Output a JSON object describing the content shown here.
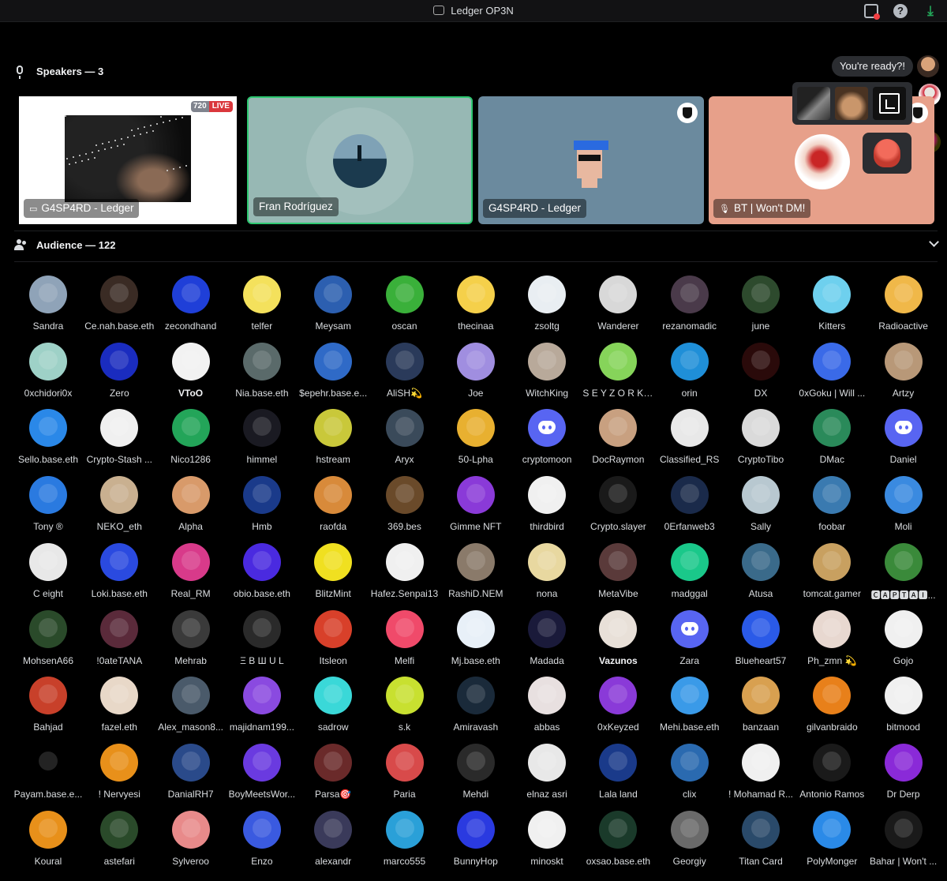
{
  "window": {
    "title": "Ledger OP3N"
  },
  "speakers": {
    "header": "Speakers — 3",
    "tiles": [
      {
        "label": "G4SP4RD - Ledger",
        "label_icon": "screen-share-icon",
        "badge_quality": "720",
        "badge_live": "LIVE"
      },
      {
        "label": "Fran Rodríguez",
        "speaking": true
      },
      {
        "label": "G4SP4RD - Ledger",
        "badge_icon": "shield-icon"
      },
      {
        "label": "BT | Won't DM!",
        "label_icon": "muted-mic-icon",
        "badge_icon": "shield-icon"
      }
    ]
  },
  "overlay": {
    "ready_text": "You're ready?!"
  },
  "audience": {
    "header": "Audience — 122",
    "members": [
      {
        "name": "Sandra",
        "color": "#8fa3b8"
      },
      {
        "name": "Ce.nah.base.eth",
        "color": "#3a2b24"
      },
      {
        "name": "zecondhand",
        "color": "#1f3fd8"
      },
      {
        "name": "telfer",
        "color": "#f4e15c"
      },
      {
        "name": "Meysam",
        "color": "#2c5fb0"
      },
      {
        "name": "oscan",
        "color": "#3ab03a"
      },
      {
        "name": "thecinaa",
        "color": "#f5d04a"
      },
      {
        "name": "zsoltg",
        "color": "#e9eef2"
      },
      {
        "name": "Wanderer",
        "color": "#d8d8d8"
      },
      {
        "name": "rezanomadic",
        "color": "#4a3a4a"
      },
      {
        "name": "june",
        "color": "#2d4a2d"
      },
      {
        "name": "Kitters",
        "color": "#6ed0ee"
      },
      {
        "name": "Radioactive",
        "color": "#f0b849"
      },
      {
        "name": "0xchidori0x",
        "color": "#9ed1c7"
      },
      {
        "name": "Zero",
        "color": "#1a2cbf"
      },
      {
        "name": "VToO",
        "color": "#f2f2f2",
        "bold": true
      },
      {
        "name": "Nia.base.eth",
        "color": "#5a6a6a"
      },
      {
        "name": "$epehr.base.e...",
        "color": "#2f6ac7"
      },
      {
        "name": "AliSH💫",
        "color": "#2a3a5a"
      },
      {
        "name": "Joe",
        "color": "#a08ee0"
      },
      {
        "name": "WitchKing",
        "color": "#b8a99a"
      },
      {
        "name": "S E Y Z O R K ...",
        "color": "#86d45a"
      },
      {
        "name": "orin",
        "color": "#1f8fd8"
      },
      {
        "name": "DX",
        "color": "#2a0a0a"
      },
      {
        "name": "0xGoku | Will ...",
        "color": "#3a6ae8"
      },
      {
        "name": "Artzy",
        "color": "#b89878"
      },
      {
        "name": "Sello.base.eth",
        "color": "#2a88e8"
      },
      {
        "name": "Crypto-Stash ...",
        "color": "#f0f0f0"
      },
      {
        "name": "Nico1286",
        "color": "#23a559"
      },
      {
        "name": "himmel",
        "color": "#1a1a22"
      },
      {
        "name": "hstream",
        "color": "#c9c83a"
      },
      {
        "name": "Aryx",
        "color": "#3a4a5a"
      },
      {
        "name": "50-Lpha",
        "color": "#e8b030"
      },
      {
        "name": "cryptomoon",
        "color": "#5865f2",
        "discord": true
      },
      {
        "name": "DocRaymon",
        "color": "#c8a080"
      },
      {
        "name": "Classified_RS",
        "color": "#e8e8e8"
      },
      {
        "name": "CryptoTibo",
        "color": "#dadada"
      },
      {
        "name": "DMac",
        "color": "#2a8a5a"
      },
      {
        "name": "Daniel",
        "color": "#eb459e",
        "discord": true
      },
      {
        "name": "Tony ®",
        "color": "#2a7ae0"
      },
      {
        "name": "NEKO_eth",
        "color": "#c9b090"
      },
      {
        "name": "Alpha",
        "color": "#d89a6a"
      },
      {
        "name": "Hmb",
        "color": "#1a3a8a"
      },
      {
        "name": "raofda",
        "color": "#d88a3a"
      },
      {
        "name": "369.bes",
        "color": "#6a4a2a"
      },
      {
        "name": "Gimme NFT",
        "color": "#8a3ad8"
      },
      {
        "name": "thirdbird",
        "color": "#f0f0f0"
      },
      {
        "name": "Crypto.slayer",
        "color": "#1a1a1a"
      },
      {
        "name": "0Erfanweb3",
        "color": "#1a2a4a"
      },
      {
        "name": "Sally",
        "color": "#b8c8d0"
      },
      {
        "name": "foobar",
        "color": "#3a7ab0"
      },
      {
        "name": "Moli",
        "color": "#3a8ae0"
      },
      {
        "name": "C eight",
        "color": "#e8e8e8"
      },
      {
        "name": "Loki.base.eth",
        "color": "#2a4ae0"
      },
      {
        "name": "Real_RM",
        "color": "#d83a8a"
      },
      {
        "name": "obio.base.eth",
        "color": "#4a2ae0"
      },
      {
        "name": "BlitzMint",
        "color": "#f0e020"
      },
      {
        "name": "Hafez.Senpai13",
        "color": "#f0f0f0"
      },
      {
        "name": "RashiD.NEM",
        "color": "#8a7a6a"
      },
      {
        "name": "nona",
        "color": "#e8d8a0"
      },
      {
        "name": "MetaVibe",
        "color": "#5a3a3a"
      },
      {
        "name": "madggal",
        "color": "#1ac88a"
      },
      {
        "name": "Atusa",
        "color": "#3a6a8a"
      },
      {
        "name": "tomcat.gamer",
        "color": "#c8a060"
      },
      {
        "name": "🅲🅰🅿🆃🅰🅸...",
        "color": "#3a8a3a"
      },
      {
        "name": "MohsenA66",
        "color": "#2a4a2a"
      },
      {
        "name": "!0ateTANA",
        "color": "#5a2a3a"
      },
      {
        "name": "Mehrab",
        "color": "#3a3a3a"
      },
      {
        "name": "Ξ В Ш U L",
        "color": "#2a2a2a"
      },
      {
        "name": "Itsleon",
        "color": "#d8402a"
      },
      {
        "name": "Melfi",
        "color": "#f04a6a"
      },
      {
        "name": "Mj.base.eth",
        "color": "#e8f0f8"
      },
      {
        "name": "Madada",
        "color": "#1a1a3a"
      },
      {
        "name": "Vazunos",
        "color": "#e8e0d8",
        "bold": true
      },
      {
        "name": "Zara",
        "color": "#80848e",
        "discord": true
      },
      {
        "name": "Blueheart57",
        "color": "#2a5ae8"
      },
      {
        "name": "Ph_zmn 💫",
        "color": "#e8d8d0"
      },
      {
        "name": "Gojo",
        "color": "#f0f0f0"
      },
      {
        "name": "Bahjad",
        "color": "#c8402a"
      },
      {
        "name": "fazel.eth",
        "color": "#e8d8c8"
      },
      {
        "name": "Alex_mason8...",
        "color": "#4a5a6a"
      },
      {
        "name": "majidnam199...",
        "color": "#8a4ae0"
      },
      {
        "name": "sadrow",
        "color": "#3ad8d8"
      },
      {
        "name": "s.k",
        "color": "#c8e030"
      },
      {
        "name": "Amiravash",
        "color": "#1a2a3a"
      },
      {
        "name": "abbas",
        "color": "#e8e0e0"
      },
      {
        "name": "0xKeyzed",
        "color": "#8a3ad8"
      },
      {
        "name": "Mehi.base.eth",
        "color": "#3a9ae8"
      },
      {
        "name": "banzaan",
        "color": "#d8a050"
      },
      {
        "name": "gilvanbraido",
        "color": "#e8801a"
      },
      {
        "name": "bitmood",
        "color": "#f0f0f0"
      },
      {
        "name": "Payam.base.e...",
        "color": "#000000"
      },
      {
        "name": "! Nervyesi",
        "color": "#e8901a"
      },
      {
        "name": "DanialRH7",
        "color": "#2a4a8a"
      },
      {
        "name": "BoyMeetsWor...",
        "color": "#6a3ae0"
      },
      {
        "name": "Parsa🎯",
        "color": "#6a2a2a"
      },
      {
        "name": "Paria",
        "color": "#d84a4a"
      },
      {
        "name": "Mehdi",
        "color": "#2a2a2a"
      },
      {
        "name": "elnaz asri",
        "color": "#e8e8e8"
      },
      {
        "name": "Lala land",
        "color": "#1a3a8a"
      },
      {
        "name": "clix",
        "color": "#2a6ab0"
      },
      {
        "name": "! Mohamad R...",
        "color": "#f0f0f0"
      },
      {
        "name": "Antonio Ramos",
        "color": "#1a1a1a"
      },
      {
        "name": "Dr Derp",
        "color": "#8a2ad8"
      },
      {
        "name": "Koural",
        "color": "#e8901a"
      },
      {
        "name": "astefari",
        "color": "#2a4a2a"
      },
      {
        "name": "Sylveroo",
        "color": "#e88a8a"
      },
      {
        "name": "Enzo",
        "color": "#3a5ae0"
      },
      {
        "name": "alexandr",
        "color": "#3a3a5a"
      },
      {
        "name": "marco555",
        "color": "#2aa0d8"
      },
      {
        "name": "BunnyHop",
        "color": "#2a3ae0"
      },
      {
        "name": "minoskt",
        "color": "#f0f0f0"
      },
      {
        "name": "oxsao.base.eth",
        "color": "#1a3a2a"
      },
      {
        "name": "Georgiy",
        "color": "#6a6a6a"
      },
      {
        "name": "Titan Card",
        "color": "#2a4a6a"
      },
      {
        "name": "PolyMonger",
        "color": "#2a8ae8"
      },
      {
        "name": "Bahar | Won't ...",
        "color": "#1a1a1a"
      }
    ]
  }
}
